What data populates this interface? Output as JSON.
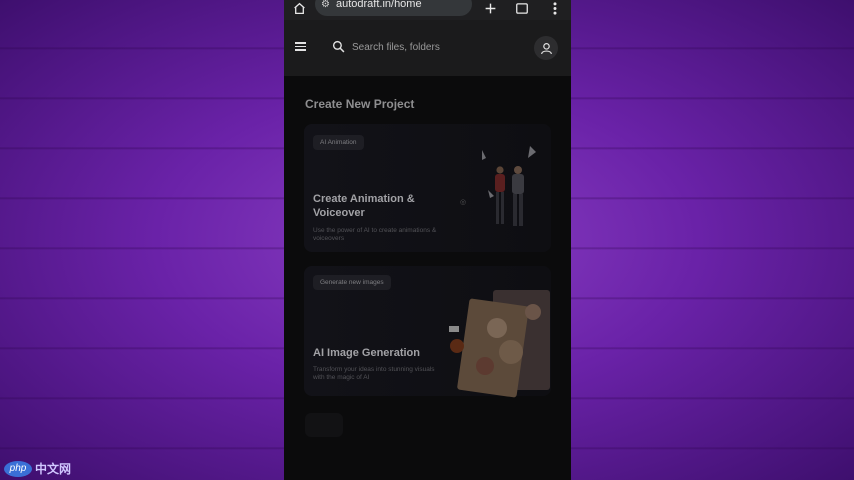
{
  "browser": {
    "url": "autodraft.in/home",
    "home_icon": "home-icon",
    "tune_icon": "tune-icon",
    "new_tab_icon": "plus-icon",
    "tabs_count": ":D",
    "menu_icon": "more-vert-icon"
  },
  "header": {
    "menu_icon": "hamburger-icon",
    "search_placeholder": "Search files, folders",
    "avatar_icon": "user-icon"
  },
  "main": {
    "title": "Create New Project",
    "cards": [
      {
        "badge": "AI Animation",
        "title": "Create Animation & Voiceover",
        "description": "Use the power of AI to create animations & voiceovers"
      },
      {
        "badge": "Generate new images",
        "title": "AI Image Generation",
        "description": "Transform your ideas into stunning visuals with the magic of AI"
      }
    ]
  },
  "watermark": {
    "logo": "php",
    "text": "中文网"
  },
  "colors": {
    "background_purple": "#6a22a8",
    "phone_bg": "#0a0a0b",
    "appbar_bg": "#1b1b1c"
  }
}
